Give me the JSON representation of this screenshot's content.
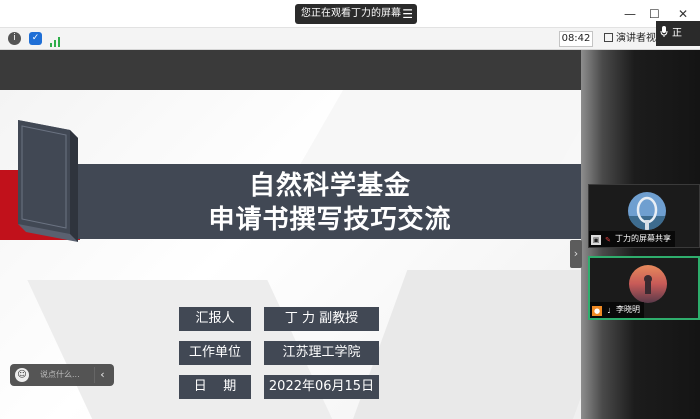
{
  "window": {
    "share_banner": "您正在观看丁力的屏幕",
    "menu_icon": "☰",
    "minimize": "—",
    "maximize": "☐",
    "close": "✕"
  },
  "toolbar": {
    "time": "08:42",
    "speaker_view": "演讲者视",
    "speaking": "正"
  },
  "slide": {
    "title_line1": "自然科学基金",
    "title_line2": "申请书撰写技巧交流",
    "rows": [
      {
        "label": "汇报人",
        "value": "丁 力 副教授"
      },
      {
        "label": "工作单位",
        "value": "江苏理工学院"
      },
      {
        "label": "日    期",
        "value": "2022年06月15日"
      }
    ]
  },
  "participants": [
    {
      "name": "丁力的屏幕共享"
    },
    {
      "name": "李晓明"
    }
  ],
  "chat": {
    "placeholder": "说点什么...",
    "emoji": "☺",
    "collapse": "‹"
  },
  "side_panel": {
    "collapse": "›"
  },
  "colors": {
    "title_band": "#414854",
    "accent_red": "#c1111b",
    "active_tile": "#2fae6d"
  }
}
